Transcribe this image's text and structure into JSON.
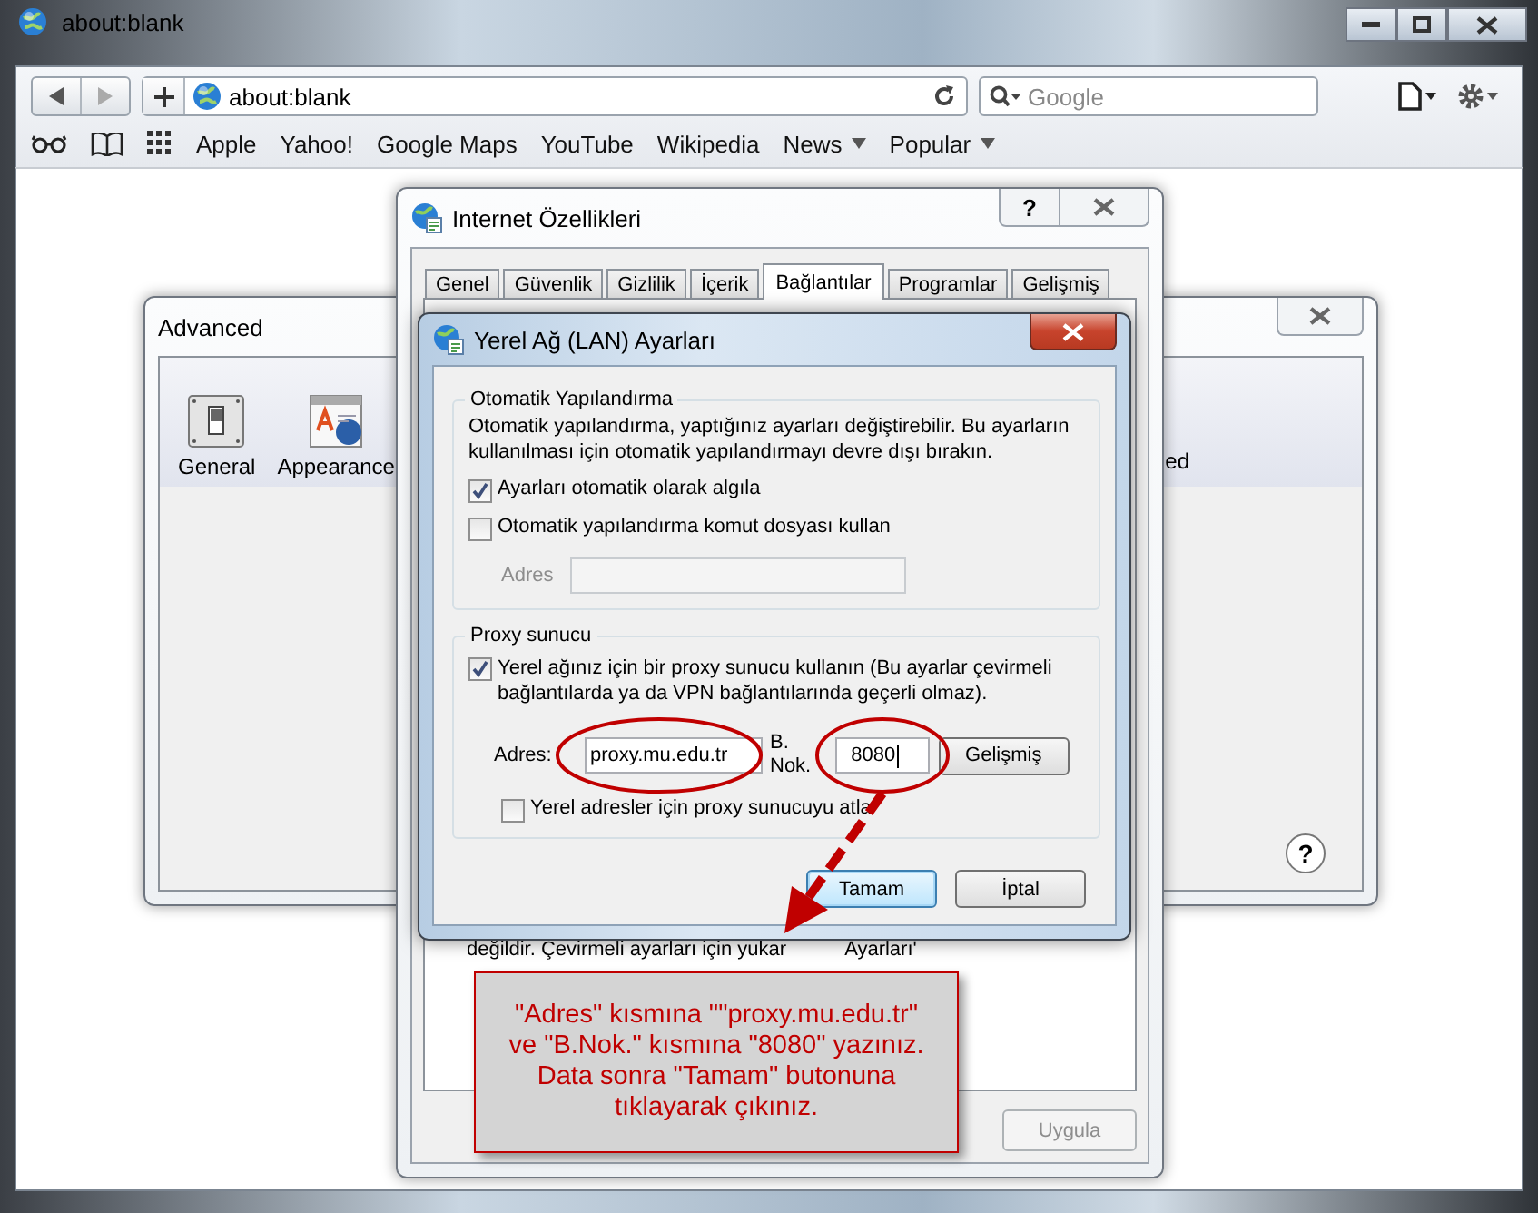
{
  "browser": {
    "title": "about:blank",
    "address": "about:blank",
    "search_placeholder": "Google",
    "bookmarks": [
      {
        "label": "Apple",
        "kind": "link"
      },
      {
        "label": "Yahoo!",
        "kind": "link"
      },
      {
        "label": "Google Maps",
        "kind": "link"
      },
      {
        "label": "YouTube",
        "kind": "link"
      },
      {
        "label": "Wikipedia",
        "kind": "link"
      },
      {
        "label": "News",
        "kind": "menu"
      },
      {
        "label": "Popular",
        "kind": "menu"
      }
    ]
  },
  "advanced_window": {
    "title": "Advanced",
    "toolbar": [
      {
        "label": "General",
        "kind": "switch"
      },
      {
        "label": "Appearance",
        "kind": "appearance"
      }
    ],
    "partial_label": "ed",
    "help": "?"
  },
  "internet_options": {
    "title": "Internet Özellikleri",
    "help": "?",
    "tabs": [
      {
        "label": "Genel",
        "selected": false
      },
      {
        "label": "Güvenlik",
        "selected": false
      },
      {
        "label": "Gizlilik",
        "selected": false
      },
      {
        "label": "İçerik",
        "selected": false
      },
      {
        "label": "Bağlantılar",
        "selected": true
      },
      {
        "label": "Programlar",
        "selected": false
      },
      {
        "label": "Gelişmiş",
        "selected": false
      }
    ],
    "background_text": [
      "değildir. Çevirmeli ayarları için yukar",
      "Ayarları'"
    ],
    "buttons": [
      {
        "label": "Uygula",
        "disabled": true
      }
    ]
  },
  "lan_dialog": {
    "title": "Yerel Ağ (LAN) Ayarları",
    "auto_group": {
      "title": "Otomatik Yapılandırma",
      "description": "Otomatik yapılandırma, yaptığınız ayarları değiştirebilir. Bu ayarların kullanılması için otomatik yapılandırmayı devre dışı bırakın.",
      "options": [
        {
          "label": "Ayarları otomatik olarak algıla",
          "checked": true
        },
        {
          "label": "Otomatik yapılandırma komut dosyası kullan",
          "checked": false
        }
      ],
      "address_label": "Adres",
      "address_disabled": true
    },
    "proxy_group": {
      "title": "Proxy sunucu",
      "use_proxy": {
        "label": "Yerel ağınız için bir proxy sunucu kullanın (Bu ayarlar çevirmeli bağlantılarda ya da VPN bağlantılarında geçerli olmaz).",
        "checked": true
      },
      "address_label": "Adres:",
      "address": "proxy.mu.edu.tr",
      "port_label_1": "B.",
      "port_label_2": "Nok.",
      "port": "8080",
      "advanced_button": "Gelişmiş",
      "bypass": {
        "label": "Yerel adresler için proxy sunucuyu atla",
        "checked": false
      }
    },
    "buttons": [
      {
        "label": "Tamam",
        "default": true
      },
      {
        "label": "İptal",
        "default": false
      }
    ]
  },
  "annotation": {
    "lines": [
      "\"Adres\" kısmına \"\"proxy.mu.edu.tr\"",
      "ve \"B.Nok.\" kısmına \"8080\" yazınız.",
      "Data sonra \"Tamam\" butonuna",
      "tıklayarak çıkınız."
    ]
  }
}
